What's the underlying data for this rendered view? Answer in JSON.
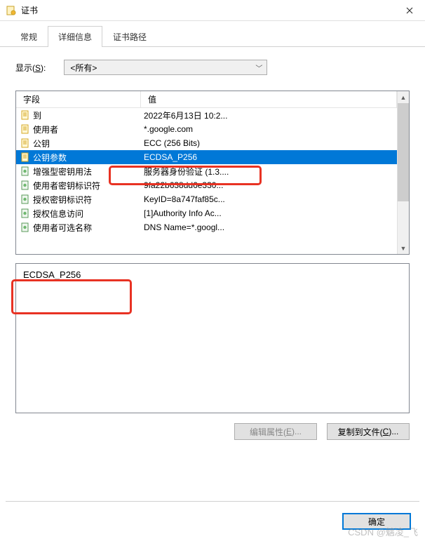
{
  "titlebar": {
    "title": "证书"
  },
  "tabs": {
    "general": "常规",
    "details": "详细信息",
    "path": "证书路径"
  },
  "show": {
    "label": "显示(S):",
    "selected": "<所有>"
  },
  "columns": {
    "field": "字段",
    "value": "值"
  },
  "rows": [
    {
      "icon": "doc",
      "field": "到",
      "value": "2022年6月13日 10:2...",
      "selected": false
    },
    {
      "icon": "doc",
      "field": "使用者",
      "value": "*.google.com",
      "selected": false
    },
    {
      "icon": "doc",
      "field": "公钥",
      "value": "ECC (256 Bits)",
      "selected": false
    },
    {
      "icon": "doc",
      "field": "公钥参数",
      "value": "ECDSA_P256",
      "selected": true
    },
    {
      "icon": "ext",
      "field": "增强型密钥用法",
      "value": "服务器身份验证 (1.3....",
      "selected": false
    },
    {
      "icon": "ext",
      "field": "使用者密钥标识符",
      "value": "9fa22b638dd6e330...",
      "selected": false
    },
    {
      "icon": "ext",
      "field": "授权密钥标识符",
      "value": "KeyID=8a747faf85c...",
      "selected": false
    },
    {
      "icon": "ext",
      "field": "授权信息访问",
      "value": "[1]Authority Info Ac...",
      "selected": false
    },
    {
      "icon": "ext",
      "field": "使用者可选名称",
      "value": "DNS Name=*.googl...",
      "selected": false
    }
  ],
  "details_text": "ECDSA_P256",
  "buttons": {
    "edit_props": "编辑属性(E)...",
    "copy_file": "复制到文件(C)...",
    "ok": "确定"
  },
  "watermark": "CSDN @魑凌_飞",
  "colors": {
    "selection": "#0078d7",
    "highlight": "#e83223"
  }
}
